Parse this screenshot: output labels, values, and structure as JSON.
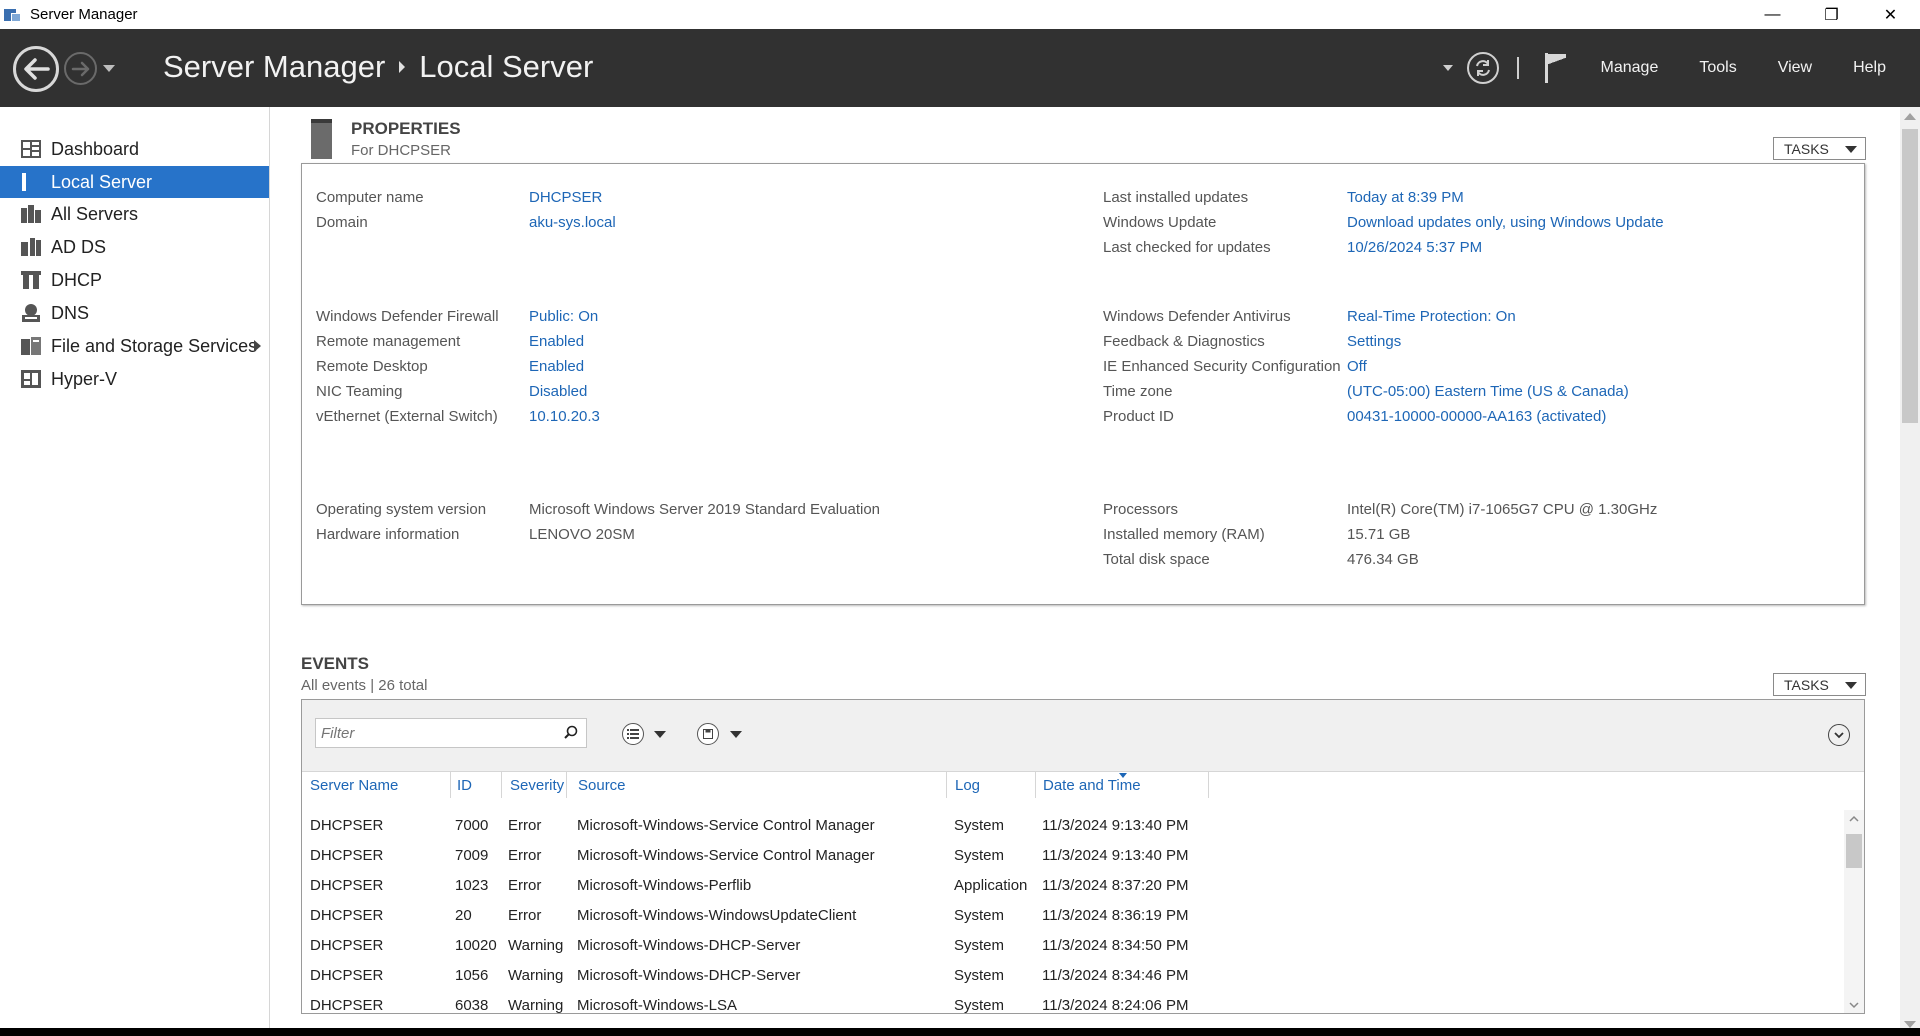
{
  "window": {
    "title": "Server Manager",
    "controls": [
      "—",
      "❐",
      "✕"
    ]
  },
  "header": {
    "breadcrumb_root": "Server Manager",
    "breadcrumb_current": "Local Server",
    "menu": [
      "Manage",
      "Tools",
      "View",
      "Help"
    ]
  },
  "sidebar": {
    "items": [
      {
        "label": "Dashboard",
        "icon": "dashboard-icon"
      },
      {
        "label": "Local Server",
        "icon": "local-server-icon",
        "active": true
      },
      {
        "label": "All Servers",
        "icon": "all-servers-icon"
      },
      {
        "label": "AD DS",
        "icon": "ad-ds-icon"
      },
      {
        "label": "DHCP",
        "icon": "dhcp-icon"
      },
      {
        "label": "DNS",
        "icon": "dns-icon"
      },
      {
        "label": "File and Storage Services",
        "icon": "file-storage-icon",
        "has_submenu": true
      },
      {
        "label": "Hyper-V",
        "icon": "hyper-v-icon"
      }
    ]
  },
  "properties": {
    "title": "PROPERTIES",
    "subtitle": "For DHCPSER",
    "tasks_label": "TASKS",
    "left": [
      {
        "label": "Computer name",
        "value": "DHCPSER",
        "link": true
      },
      {
        "label": "Domain",
        "value": "aku-sys.local",
        "link": true
      },
      {
        "label": "Windows Defender Firewall",
        "value": "Public: On",
        "link": true
      },
      {
        "label": "Remote management",
        "value": "Enabled",
        "link": true
      },
      {
        "label": "Remote Desktop",
        "value": "Enabled",
        "link": true
      },
      {
        "label": "NIC Teaming",
        "value": "Disabled",
        "link": true
      },
      {
        "label": "vEthernet (External Switch)",
        "value": "10.10.20.3",
        "link": true
      },
      {
        "label": "Operating system version",
        "value": "Microsoft Windows Server 2019 Standard Evaluation",
        "link": false
      },
      {
        "label": "Hardware information",
        "value": "LENOVO 20SM",
        "link": false
      }
    ],
    "right": [
      {
        "label": "Last installed updates",
        "value": "Today at 8:39 PM",
        "link": true
      },
      {
        "label": "Windows Update",
        "value": "Download updates only, using Windows Update",
        "link": true
      },
      {
        "label": "Last checked for updates",
        "value": "10/26/2024 5:37 PM",
        "link": true
      },
      {
        "label": "Windows Defender Antivirus",
        "value": "Real-Time Protection: On",
        "link": true
      },
      {
        "label": "Feedback & Diagnostics",
        "value": "Settings",
        "link": true
      },
      {
        "label": "IE Enhanced Security Configuration",
        "value": "Off",
        "link": true
      },
      {
        "label": "Time zone",
        "value": "(UTC-05:00) Eastern Time (US & Canada)",
        "link": true
      },
      {
        "label": "Product ID",
        "value": "00431-10000-00000-AA163 (activated)",
        "link": true
      },
      {
        "label": "Processors",
        "value": "Intel(R) Core(TM) i7-1065G7 CPU @ 1.30GHz",
        "link": false
      },
      {
        "label": "Installed memory (RAM)",
        "value": "15.71 GB",
        "link": false
      },
      {
        "label": "Total disk space",
        "value": "476.34 GB",
        "link": false
      }
    ]
  },
  "events": {
    "title": "EVENTS",
    "subtitle": "All events | 26 total",
    "tasks_label": "TASKS",
    "filter_placeholder": "Filter",
    "columns": [
      "Server Name",
      "ID",
      "Severity",
      "Source",
      "Log",
      "Date and Time"
    ],
    "rows": [
      [
        "DHCPSER",
        "7000",
        "Error",
        "Microsoft-Windows-Service Control Manager",
        "System",
        "11/3/2024 9:13:40 PM"
      ],
      [
        "DHCPSER",
        "7009",
        "Error",
        "Microsoft-Windows-Service Control Manager",
        "System",
        "11/3/2024 9:13:40 PM"
      ],
      [
        "DHCPSER",
        "1023",
        "Error",
        "Microsoft-Windows-Perflib",
        "Application",
        "11/3/2024 8:37:20 PM"
      ],
      [
        "DHCPSER",
        "20",
        "Error",
        "Microsoft-Windows-WindowsUpdateClient",
        "System",
        "11/3/2024 8:36:19 PM"
      ],
      [
        "DHCPSER",
        "10020",
        "Warning",
        "Microsoft-Windows-DHCP-Server",
        "System",
        "11/3/2024 8:34:50 PM"
      ],
      [
        "DHCPSER",
        "1056",
        "Warning",
        "Microsoft-Windows-DHCP-Server",
        "System",
        "11/3/2024 8:34:46 PM"
      ],
      [
        "DHCPSER",
        "6038",
        "Warning",
        "Microsoft-Windows-LSA",
        "System",
        "11/3/2024 8:24:06 PM"
      ]
    ]
  },
  "colors": {
    "accent": "#2773c9",
    "link": "#1d66b6",
    "header_bg": "#313131"
  }
}
